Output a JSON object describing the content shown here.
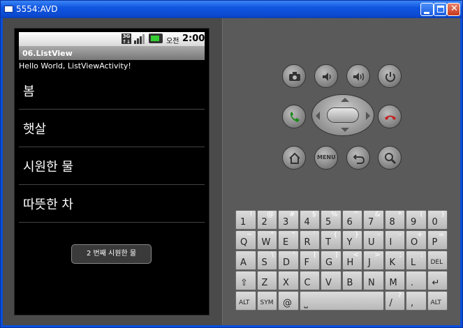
{
  "window": {
    "title": "5554:AVD"
  },
  "status": {
    "time": "2:00",
    "am": "오전"
  },
  "app": {
    "title": "06.ListView",
    "hello": "Hello World, ListViewActivity!"
  },
  "list": [
    "봄",
    "햇살",
    "시원한 물",
    "따뜻한 차"
  ],
  "toast": "2 번째 시원한 물",
  "buttons": {
    "menu": "MENU"
  },
  "keys": {
    "row1": [
      [
        "1",
        "!"
      ],
      [
        "2",
        "@"
      ],
      [
        "3",
        "#"
      ],
      [
        "4",
        "$"
      ],
      [
        "5",
        "%"
      ],
      [
        "6",
        "^"
      ],
      [
        "7",
        "&"
      ],
      [
        "8",
        "*"
      ],
      [
        "9",
        "("
      ],
      [
        "0",
        ")"
      ]
    ],
    "row2": [
      [
        "Q",
        "~"
      ],
      [
        "W",
        "\""
      ],
      [
        "E",
        "\""
      ],
      [
        "R",
        "`"
      ],
      [
        "T",
        "{"
      ],
      [
        "Y",
        "}"
      ],
      [
        "U",
        "-"
      ],
      [
        "I",
        "-"
      ],
      [
        "O",
        "+"
      ],
      [
        "P",
        "="
      ]
    ],
    "row3": [
      [
        "A",
        ""
      ],
      [
        "S",
        "\\"
      ],
      [
        "D",
        "'"
      ],
      [
        "F",
        "["
      ],
      [
        "G",
        "]"
      ],
      [
        "H",
        "<"
      ],
      [
        "J",
        ">"
      ],
      [
        "K",
        ";"
      ],
      [
        "L",
        ":"
      ],
      [
        "DEL",
        ""
      ]
    ],
    "row4": [
      [
        "⇧",
        ""
      ],
      [
        "Z",
        ""
      ],
      [
        "X",
        ""
      ],
      [
        "C",
        ""
      ],
      [
        "V",
        ""
      ],
      [
        "B",
        ""
      ],
      [
        "N",
        ""
      ],
      [
        "M",
        ""
      ],
      [
        ".",
        ""
      ],
      [
        "↵",
        ""
      ]
    ],
    "row5": {
      "alt_left": "ALT",
      "sym": "SYM",
      "at": "@",
      "slash": "/",
      "slash_s": "?",
      "comma": ",",
      "alt_right": "ALT"
    }
  }
}
